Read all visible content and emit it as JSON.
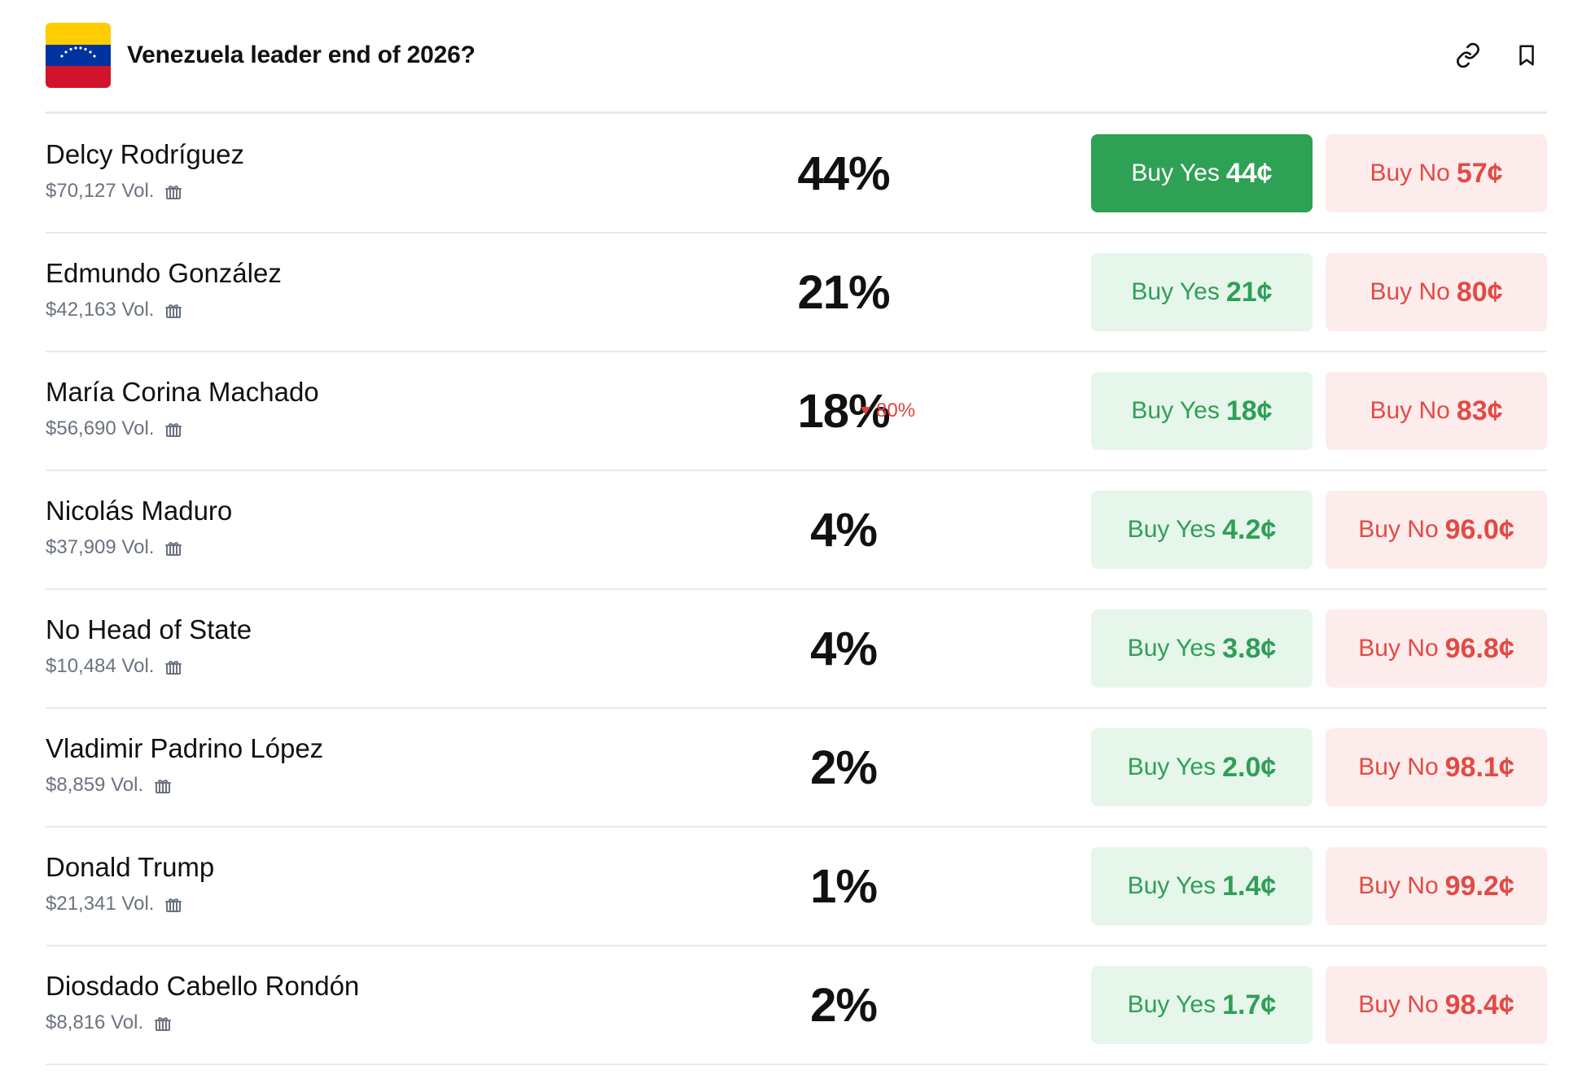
{
  "header": {
    "title": "Venezuela leader end of 2026?",
    "flag_icon": "venezuela-flag",
    "actions": [
      "link-icon",
      "bookmark-icon"
    ],
    "colors": {
      "flag_yellow": "#ffcd00",
      "flag_blue": "#0033a0",
      "flag_red": "#cf142b"
    }
  },
  "theme": {
    "yes_bg": "#e6f6ea",
    "yes_text": "#2f9f58",
    "yes_active_bg": "#2ea155",
    "no_bg": "#fdecec",
    "no_text": "#e14b45"
  },
  "rows": [
    {
      "name": "Delcy Rodríguez",
      "volume": "$70,127 Vol.",
      "percent": "44%",
      "yes_label": "Buy Yes",
      "yes_price": "44¢",
      "no_label": "Buy No",
      "no_price": "57¢",
      "yes_active": true
    },
    {
      "name": "Edmundo González",
      "volume": "$42,163 Vol.",
      "percent": "21%",
      "yes_label": "Buy Yes",
      "yes_price": "21¢",
      "no_label": "Buy No",
      "no_price": "80¢"
    },
    {
      "name": "María Corina Machado",
      "volume": "$56,690 Vol.",
      "percent": "18%",
      "change": "80%",
      "change_direction": "down",
      "yes_label": "Buy Yes",
      "yes_price": "18¢",
      "no_label": "Buy No",
      "no_price": "83¢"
    },
    {
      "name": "Nicolás Maduro",
      "volume": "$37,909 Vol.",
      "percent": "4%",
      "yes_label": "Buy Yes",
      "yes_price": "4.2¢",
      "no_label": "Buy No",
      "no_price": "96.0¢"
    },
    {
      "name": "No Head of State",
      "volume": "$10,484 Vol.",
      "percent": "4%",
      "yes_label": "Buy Yes",
      "yes_price": "3.8¢",
      "no_label": "Buy No",
      "no_price": "96.8¢"
    },
    {
      "name": "Vladimir Padrino López",
      "volume": "$8,859 Vol.",
      "percent": "2%",
      "yes_label": "Buy Yes",
      "yes_price": "2.0¢",
      "no_label": "Buy No",
      "no_price": "98.1¢"
    },
    {
      "name": "Donald Trump",
      "volume": "$21,341 Vol.",
      "percent": "1%",
      "yes_label": "Buy Yes",
      "yes_price": "1.4¢",
      "no_label": "Buy No",
      "no_price": "99.2¢"
    },
    {
      "name": "Diosdado Cabello Rondón",
      "volume": "$8,816 Vol.",
      "percent": "2%",
      "yes_label": "Buy Yes",
      "yes_price": "1.7¢",
      "no_label": "Buy No",
      "no_price": "98.4¢"
    }
  ]
}
